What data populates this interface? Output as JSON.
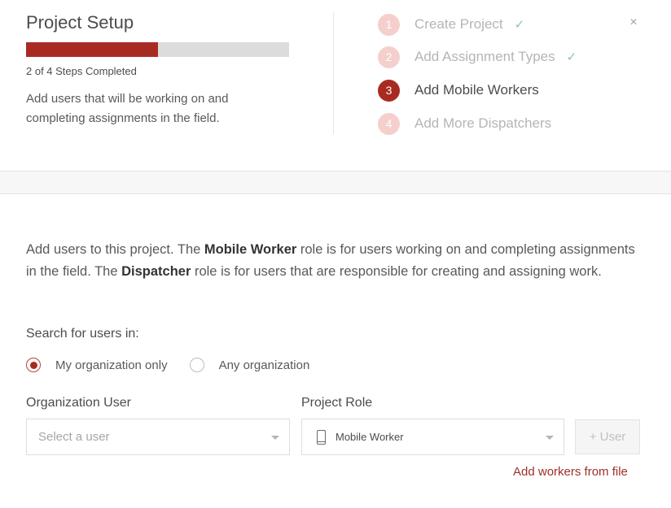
{
  "header": {
    "title": "Project Setup",
    "progress": {
      "completed": 2,
      "total": 4,
      "fraction": 0.5,
      "fill_color": "#a82b22",
      "track_color": "#dcdcdc"
    },
    "steps_completed_text": "2 of 4 Steps Completed",
    "step_description": "Add users that will be working on and completing assignments in the field.",
    "close_icon": "×"
  },
  "steps": [
    {
      "number": "1",
      "label": "Create Project",
      "state": "completed",
      "check": "✓"
    },
    {
      "number": "2",
      "label": "Add Assignment Types",
      "state": "completed",
      "check": "✓"
    },
    {
      "number": "3",
      "label": "Add Mobile Workers",
      "state": "active",
      "check": ""
    },
    {
      "number": "4",
      "label": "Add More Dispatchers",
      "state": "pending",
      "check": ""
    }
  ],
  "body": {
    "intro": {
      "part1": "Add users to this project. The ",
      "bold1": "Mobile Worker",
      "part2": " role is for users working on and completing assignments in the field. The ",
      "bold2": "Dispatcher",
      "part3": " role is for users that are responsible for creating and assigning work."
    },
    "search_label": "Search for users in:",
    "radio_options": [
      {
        "label": "My organization only",
        "checked": true
      },
      {
        "label": "Any organization",
        "checked": false
      }
    ],
    "org_user": {
      "label": "Organization User",
      "placeholder": "Select a user",
      "value": ""
    },
    "project_role": {
      "label": "Project Role",
      "value": "Mobile Worker",
      "icon": "mobile-phone-icon"
    },
    "add_user_button": "+ User",
    "add_from_file_link": "Add workers from file"
  },
  "colors": {
    "accent": "#a82b22",
    "step_pending": "#f5cfcb",
    "check": "#8fc49a",
    "link": "#a02f27"
  }
}
